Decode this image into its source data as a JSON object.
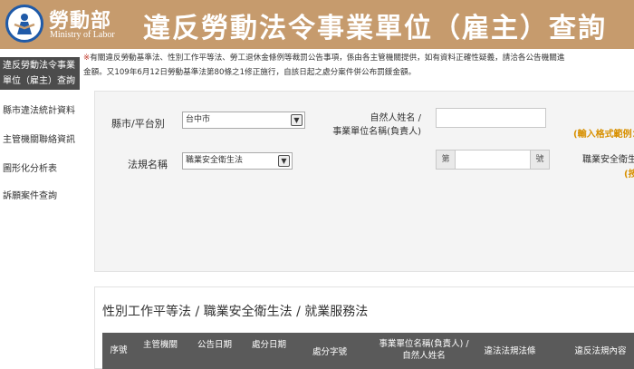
{
  "header": {
    "logo_cn": "勞動部",
    "logo_en": "Ministry of Labor",
    "title": "違反勞動法令事業單位（雇主）查詢系統"
  },
  "sidebar": {
    "items": [
      {
        "label_line1": "違反勞動法令事業",
        "label_line2": "單位（雇主）查詢",
        "active": true
      },
      {
        "label": "縣市違法統計資料"
      },
      {
        "label": "主管機關聯絡資訊"
      },
      {
        "label": "圖形化分析表"
      },
      {
        "label": "訴願案件查詢"
      }
    ]
  },
  "notice": {
    "mark": "※",
    "line1": "有關違反勞動基準法、性別工作平等法、勞工退休金條例等裁罰公告事項，係由各主管機關提供，如有資料正確性疑義，請洽各公告機關進",
    "line2": "金額。又109年6月12日勞動基準法第80條之1修正施行，自該日起之處分案件併公布罰鍰金額。"
  },
  "form": {
    "city_label": "縣市/平台別",
    "city_value": "台中市",
    "law_label": "法規名稱",
    "law_value": "職業安全衛生法",
    "name_label_line1": "自然人姓名 /",
    "name_label_line2": "事業單位名稱(負責人)",
    "name_value": "",
    "doc_prefix": "第",
    "doc_suffix": "號",
    "doc_value": "",
    "hint_format": "(輸入格式範例：",
    "hint_law": "職業安全衛生",
    "hint_example": "(按"
  },
  "results": {
    "title": "性別工作平等法 / 職業安全衛生法 / 就業服務法",
    "columns": [
      "序號",
      "主管機關",
      "公告日期",
      "處分日期",
      "處分字號",
      "事業單位名稱(負責人) / 自然人姓名",
      "違法法規法條",
      "違反法規內容"
    ]
  },
  "icons": {
    "logo": "ministry-logo-icon",
    "dropdown": "chevron-down-icon"
  },
  "colors": {
    "header_bg": "#c69b6d",
    "active_nav_bg": "#4c4c4c",
    "table_header_bg": "#5a5a5a",
    "hint": "#d89000",
    "logo_blue": "#1f5aa8"
  }
}
